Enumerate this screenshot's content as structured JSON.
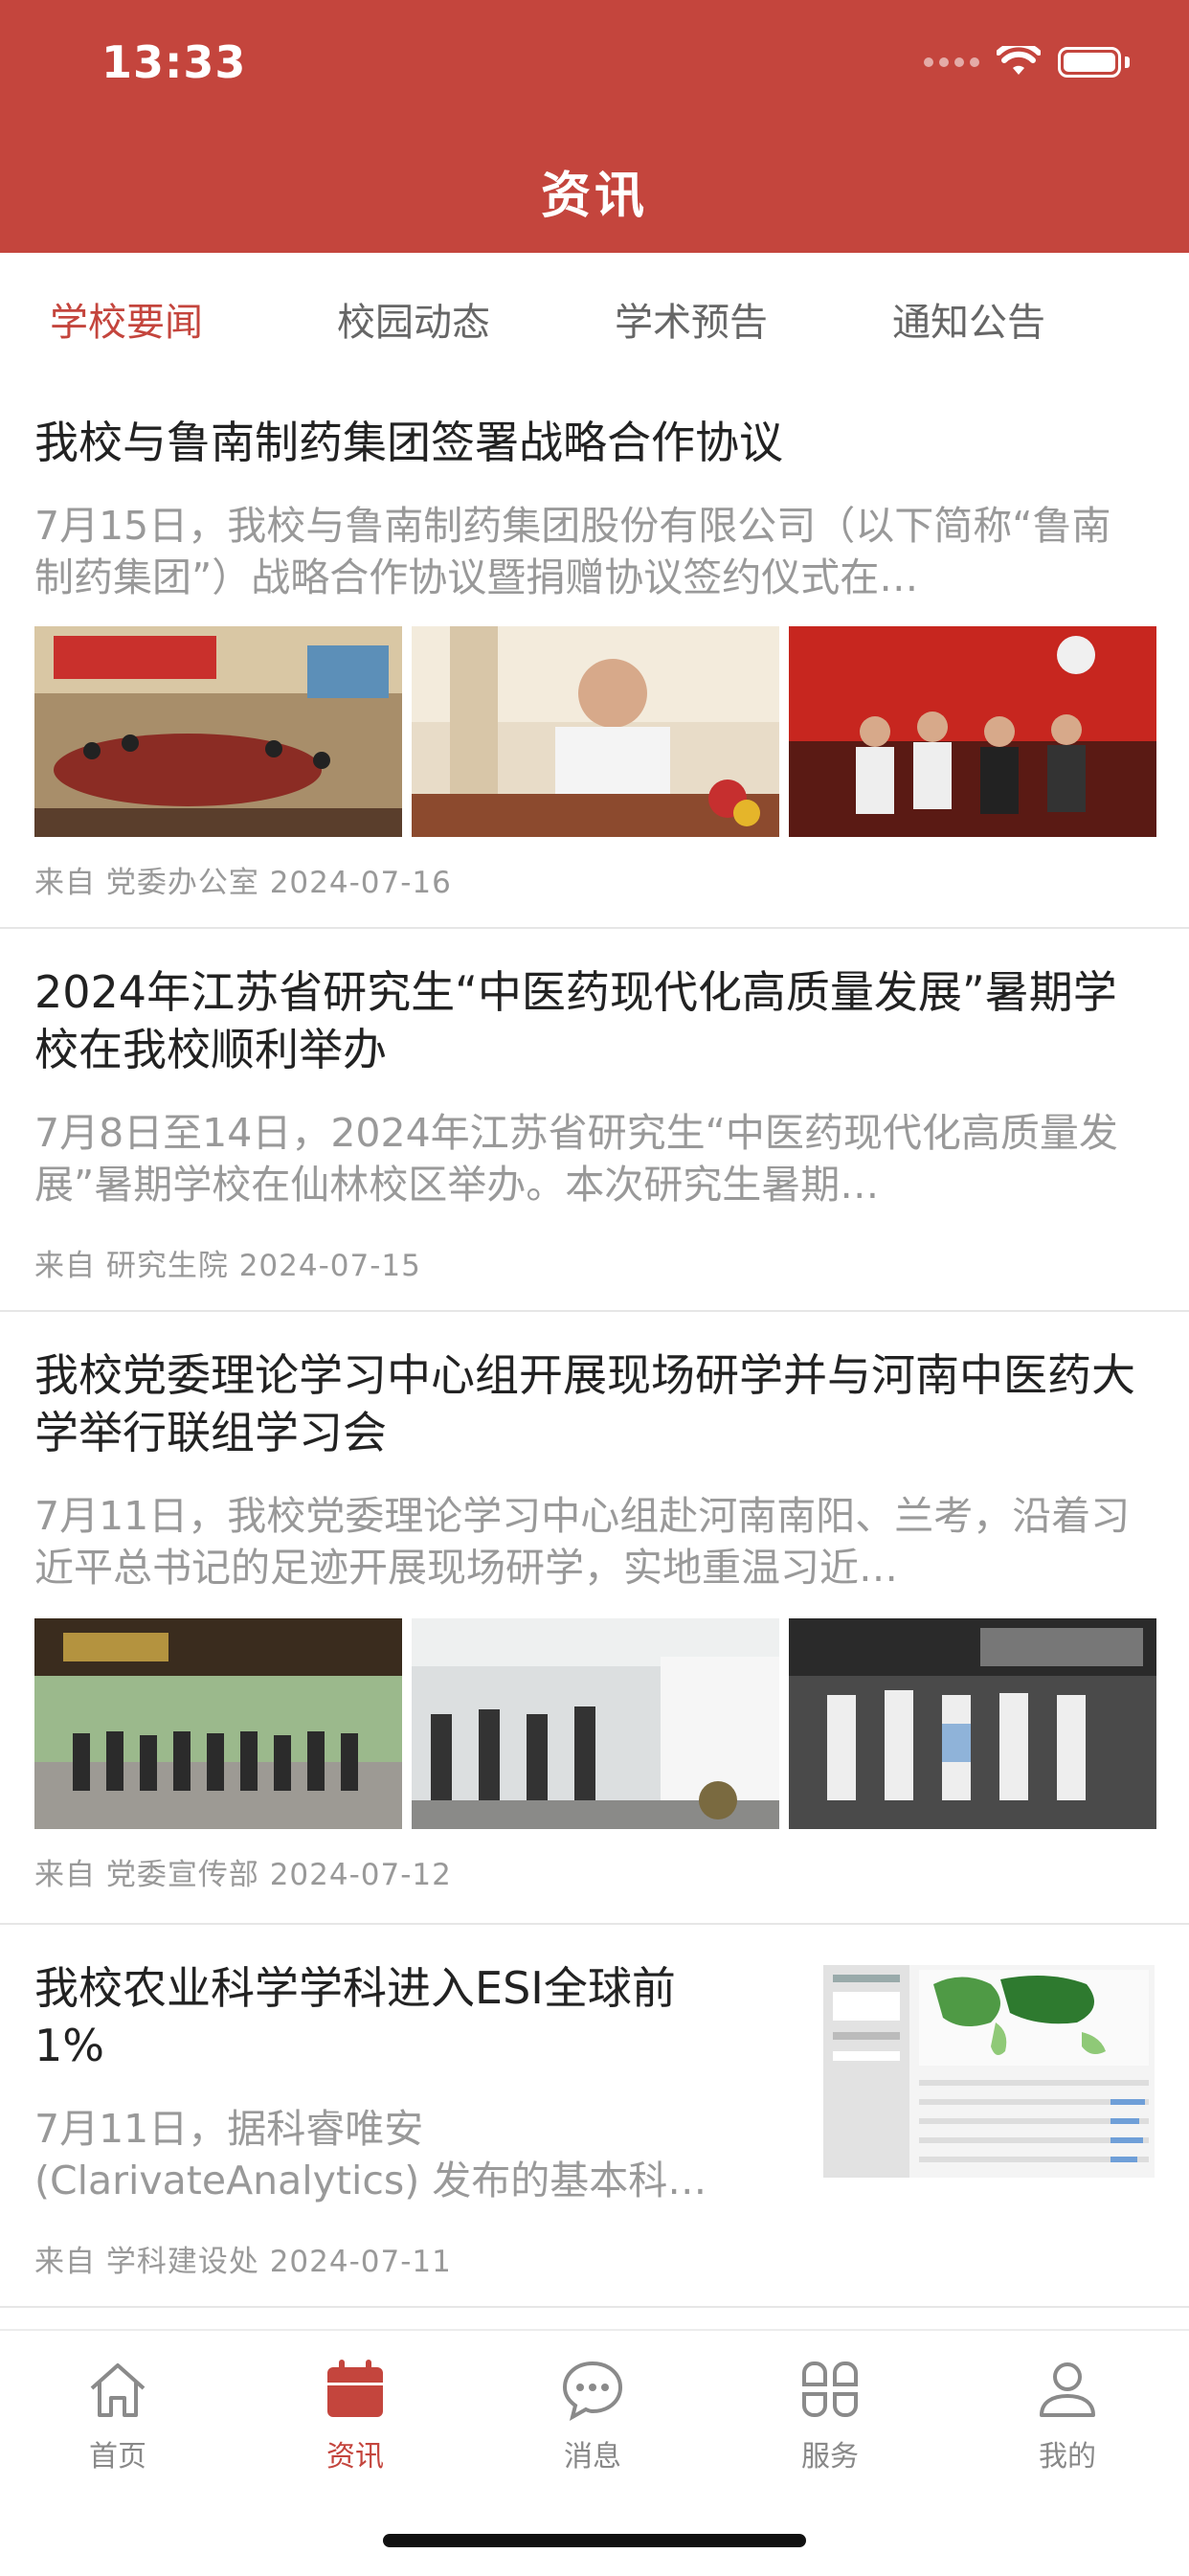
{
  "status_bar": {
    "time": "13:33"
  },
  "header": {
    "title": "资讯"
  },
  "tabs": [
    {
      "label": "学校要闻",
      "active": true
    },
    {
      "label": "校园动态",
      "active": false
    },
    {
      "label": "学术预告",
      "active": false
    },
    {
      "label": "通知公告",
      "active": false
    }
  ],
  "articles": [
    {
      "title": "我校与鲁南制药集团签署战略合作协议",
      "summary": "7月15日，我校与鲁南制药集团股份有限公司（以下简称“鲁南制药集团”）战略合作协议暨捐赠协议签约仪式在…",
      "meta": "来自 党委办公室 2024-07-16",
      "images": [
        "meeting-room-photo",
        "speaker-photo",
        "signing-ceremony-photo"
      ]
    },
    {
      "title": "2024年江苏省研究生“中医药现代化高质量发展”暑期学校在我校顺利举办",
      "summary": "7月8日至14日，2024年江苏省研究生“中医药现代化高质量发展”暑期学校在仙林校区举办。本次研究生暑期…",
      "meta": "来自 研究生院 2024-07-15"
    },
    {
      "title": "我校党委理论学习中心组开展现场研学并与河南中医药大学举行联组学习会",
      "summary": "7月11日，我校党委理论学习中心组赴河南南阳、兰考，沿着习近平总书记的足迹开展现场研学，实地重温习近…",
      "meta": "来自 党委宣传部 2024-07-12",
      "images": [
        "group-photo",
        "exhibition-visit-photo",
        "museum-visit-photo"
      ]
    },
    {
      "title": "我校农业科学学科进入ESI全球前1%",
      "summary": "7月11日，据科睿唯安(ClarivateAnalytics) 发布的基本科…",
      "meta": "来自 学科建设处 2024-07-11",
      "thumbnail": "esi-world-map-screenshot"
    }
  ],
  "tabbar": [
    {
      "label": "首页",
      "icon": "home-icon",
      "active": false
    },
    {
      "label": "资讯",
      "icon": "calendar-news-icon",
      "active": true
    },
    {
      "label": "消息",
      "icon": "chat-bubble-icon",
      "active": false
    },
    {
      "label": "服务",
      "icon": "grid-flower-icon",
      "active": false
    },
    {
      "label": "我的",
      "icon": "person-icon",
      "active": false
    }
  ],
  "colors": {
    "brand": "#c4453d",
    "text": "#222222",
    "muted": "#999999"
  }
}
